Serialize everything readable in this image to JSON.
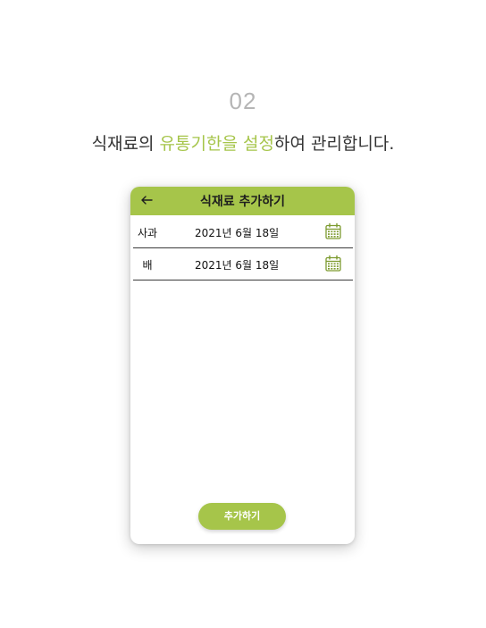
{
  "colors": {
    "accent": "#a6c54a",
    "icon_green": "#7d9b2f"
  },
  "intro": {
    "step": "02",
    "headline_before": "식재료의 ",
    "headline_highlight_1": "유통기한을",
    "headline_space": " ",
    "headline_highlight_2": "설정",
    "headline_after": "하여 관리합니다."
  },
  "app": {
    "header": {
      "back_icon": "arrow-left-icon",
      "title": "식재료 추가하기"
    },
    "items": [
      {
        "name": "사과",
        "date": "2021년 6월 18일",
        "icon": "calendar-icon"
      },
      {
        "name": "배",
        "date": "2021년 6월 18일",
        "icon": "calendar-icon"
      }
    ],
    "add_button_label": "추가하기"
  }
}
